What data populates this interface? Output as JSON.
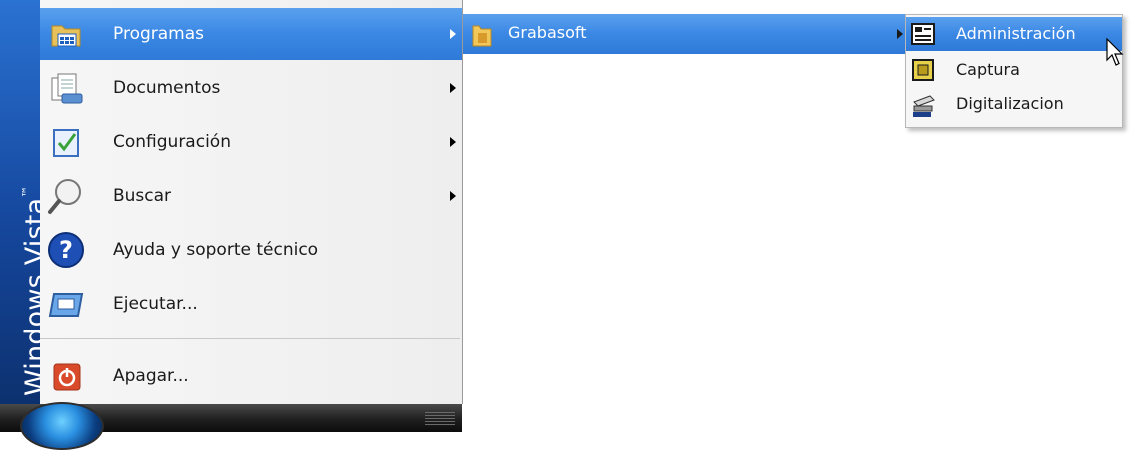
{
  "brand": {
    "text": "Windows Vista",
    "tm": "™"
  },
  "start_menu": {
    "items": [
      {
        "label": "Programas",
        "icon": "programs-folder-icon",
        "has_submenu": true,
        "highlighted": true
      },
      {
        "label": "Documentos",
        "icon": "documents-icon",
        "has_submenu": true
      },
      {
        "label": "Configuración",
        "icon": "settings-icon",
        "has_submenu": true
      },
      {
        "label": "Buscar",
        "icon": "search-icon",
        "has_submenu": true
      },
      {
        "label": "Ayuda y soporte técnico",
        "icon": "help-icon",
        "has_submenu": false
      },
      {
        "label": "Ejecutar...",
        "icon": "run-icon",
        "has_submenu": false
      },
      {
        "label": "Apagar...",
        "icon": "power-icon",
        "has_submenu": false
      }
    ]
  },
  "programs_submenu": {
    "items": [
      {
        "label": "Grabasoft",
        "icon": "folder-icon",
        "has_submenu": true,
        "highlighted": true
      }
    ]
  },
  "grabasoft_submenu": {
    "items": [
      {
        "label": "Administración",
        "icon": "admin-icon",
        "highlighted": true
      },
      {
        "label": "Captura",
        "icon": "capture-icon"
      },
      {
        "label": "Digitalizacion",
        "icon": "scanner-icon"
      }
    ]
  },
  "colors": {
    "highlight": "#3a87e4",
    "brand_bar": "#15479d",
    "taskbar": "#1f1f1f"
  }
}
